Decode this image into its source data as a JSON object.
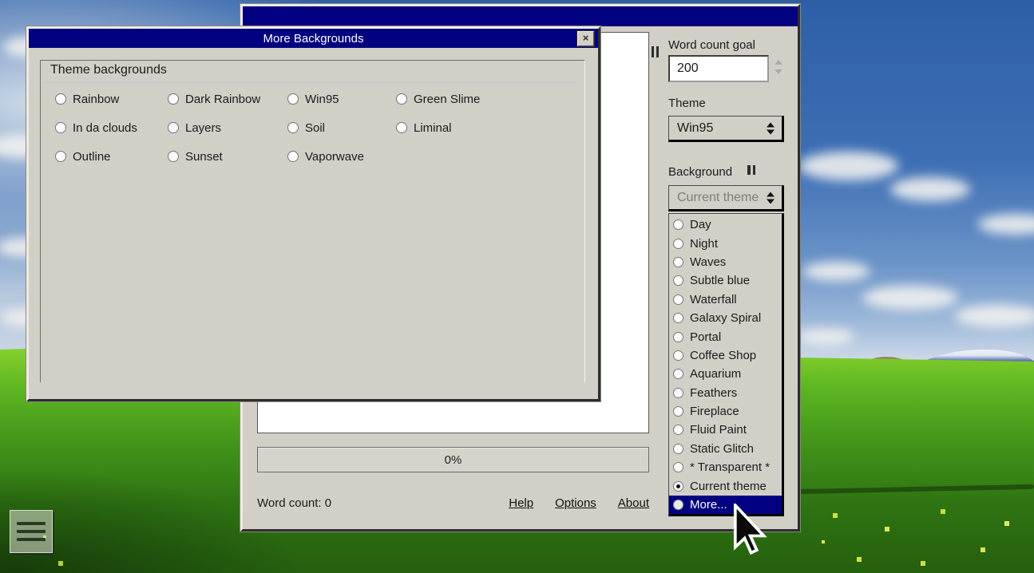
{
  "colors": {
    "titlebar": "#000080",
    "highlight": "#000080",
    "window_bg": "#d2cfc7"
  },
  "dialog": {
    "title": "More Backgrounds",
    "close_glyph": "×",
    "group_title": "Theme backgrounds",
    "options": [
      "Rainbow",
      "Dark Rainbow",
      "Win95",
      "Green Slime",
      "In da clouds",
      "Layers",
      "Soil",
      "Liminal",
      "Outline",
      "Sunset",
      "Vaporwave"
    ]
  },
  "main_window": {
    "progress_label": "0%",
    "word_count_text": "Word count: 0",
    "footer_links": [
      "Help",
      "Options",
      "About"
    ],
    "editor_text": "",
    "sidebar": {
      "word_count_goal_label": "Word count goal",
      "word_count_goal_value": "200",
      "theme_label": "Theme",
      "theme_value": "Win95",
      "background_label": "Background",
      "background_value": "Current theme",
      "background_options": [
        {
          "label": "Day",
          "selected": false,
          "highlighted": false
        },
        {
          "label": "Night",
          "selected": false,
          "highlighted": false
        },
        {
          "label": "Waves",
          "selected": false,
          "highlighted": false
        },
        {
          "label": "Subtle blue",
          "selected": false,
          "highlighted": false
        },
        {
          "label": "Waterfall",
          "selected": false,
          "highlighted": false
        },
        {
          "label": "Galaxy Spiral",
          "selected": false,
          "highlighted": false
        },
        {
          "label": "Portal",
          "selected": false,
          "highlighted": false
        },
        {
          "label": "Coffee Shop",
          "selected": false,
          "highlighted": false
        },
        {
          "label": "Aquarium",
          "selected": false,
          "highlighted": false
        },
        {
          "label": "Feathers",
          "selected": false,
          "highlighted": false
        },
        {
          "label": "Fireplace",
          "selected": false,
          "highlighted": false
        },
        {
          "label": "Fluid Paint",
          "selected": false,
          "highlighted": false
        },
        {
          "label": "Static Glitch",
          "selected": false,
          "highlighted": false
        },
        {
          "label": "* Transparent *",
          "selected": false,
          "highlighted": false
        },
        {
          "label": "Current theme",
          "selected": true,
          "highlighted": false
        },
        {
          "label": "More...",
          "selected": false,
          "highlighted": true
        }
      ]
    }
  }
}
